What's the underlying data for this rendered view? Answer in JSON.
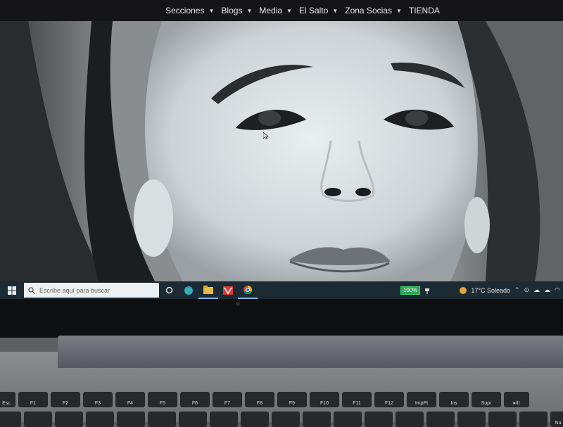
{
  "website": {
    "nav": [
      {
        "label": "Secciones",
        "has_caret": true
      },
      {
        "label": "Blogs",
        "has_caret": true
      },
      {
        "label": "Media",
        "has_caret": true
      },
      {
        "label": "El Salto",
        "has_caret": true
      },
      {
        "label": "Zona Socias",
        "has_caret": true
      },
      {
        "label": "TIENDA",
        "has_caret": false
      }
    ]
  },
  "taskbar": {
    "search_placeholder": "Escribe aquí para buscar",
    "pinned_icons": [
      "cortana-icon",
      "edge-icon",
      "file-explorer-icon",
      "app-icon",
      "chrome-icon"
    ],
    "battery_label": "100%",
    "weather": "17°C  Soleado",
    "colors": {
      "taskbar": "#1c2a33",
      "battery": "#2ea558"
    }
  },
  "keyboard": {
    "function_row": [
      "Esc",
      "F1",
      "F2",
      "F3",
      "F4",
      "F5",
      "F6",
      "F7",
      "F8",
      "F9",
      "F10",
      "F11",
      "F12",
      "ImpPt",
      "Ins",
      "Supr",
      "▸/II"
    ],
    "second_row_last": "Nu"
  }
}
